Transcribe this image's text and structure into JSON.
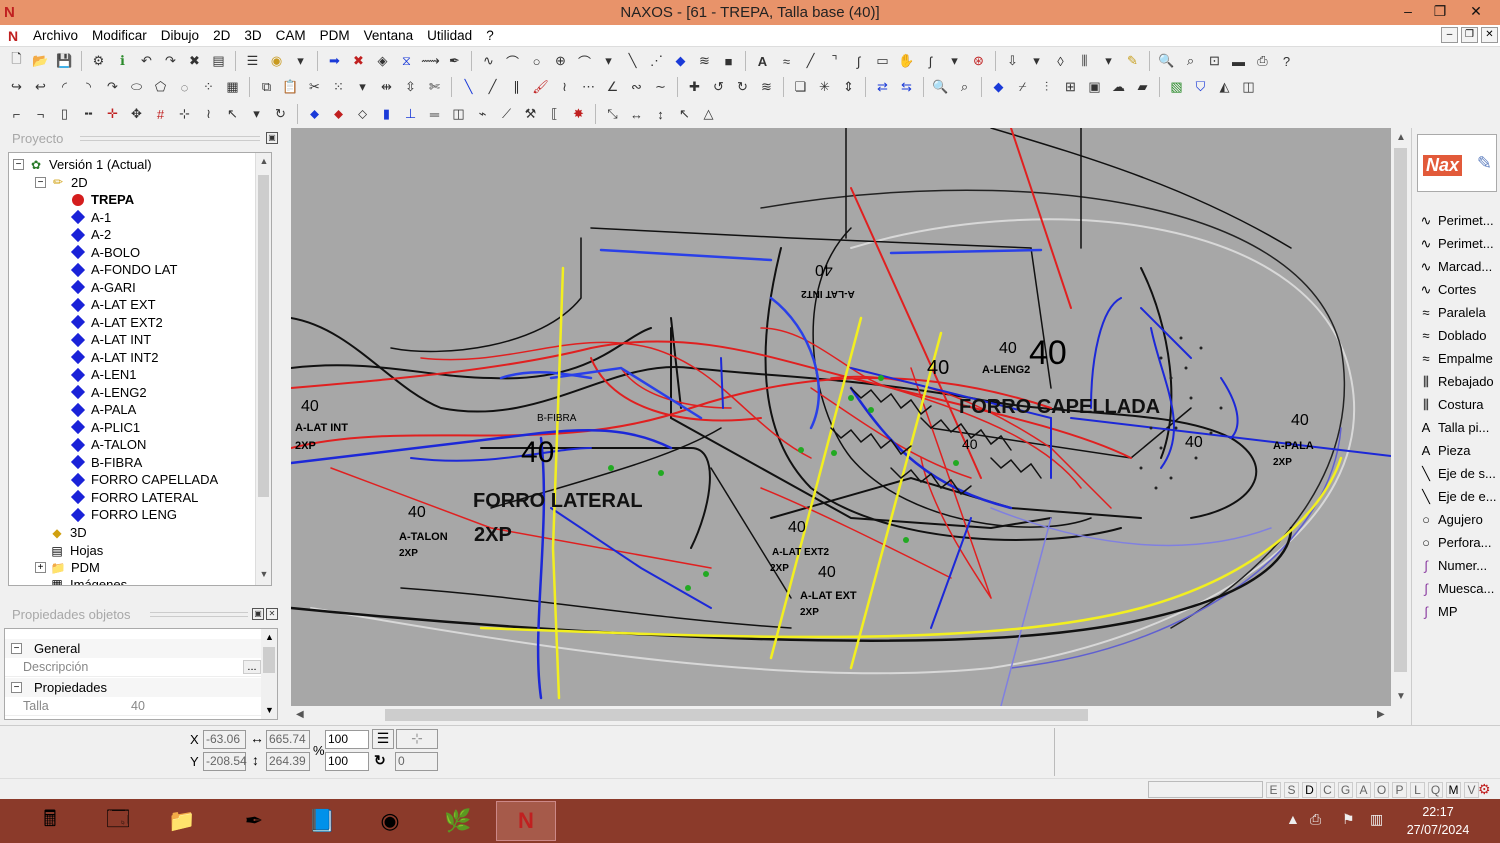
{
  "window": {
    "title": "NAXOS - [61 - TREPA, Talla base (40)]",
    "minimize": "–",
    "maximize": "❐",
    "close": "✕"
  },
  "menu": [
    "Archivo",
    "Modificar",
    "Dibujo",
    "2D",
    "3D",
    "CAM",
    "PDM",
    "Ventana",
    "Utilidad",
    "?"
  ],
  "project_panel": {
    "title": "Proyecto",
    "version": "Versión 1 (Actual)",
    "group_2d": "2D",
    "items": [
      "TREPA",
      "A-1",
      "A-2",
      "A-BOLO",
      "A-FONDO LAT",
      "A-GARI",
      "A-LAT EXT",
      "A-LAT EXT2",
      "A-LAT INT",
      "A-LAT INT2",
      "A-LEN1",
      "A-LENG2",
      "A-PALA",
      "A-PLIC1",
      "A-TALON",
      "B-FIBRA",
      "FORRO CAPELLADA",
      "FORRO LATERAL",
      "FORRO LENG"
    ],
    "group_3d": "3D",
    "hojas": "Hojas",
    "pdm": "PDM",
    "imagenes": "Imágenes"
  },
  "properties_panel": {
    "title": "Propiedades objetos",
    "cat_general": "General",
    "descripcion_label": "Descripción",
    "descripcion_value": "",
    "ellipsis": "...",
    "cat_propiedades": "Propiedades",
    "talla_label": "Talla",
    "talla_value": "40"
  },
  "canvas_labels": {
    "forro_lateral": "FORRO LATERAL",
    "forro_lateral_2xp": "2XP",
    "forro_capellada": "FORRO CAPELLADA",
    "a_lat_int": "A-LAT INT",
    "a_talon": "A-TALON",
    "a_lat_ext": "A-LAT EXT",
    "a_lat_ext2": "A-LAT EXT2",
    "a_leng2": "A-LENG2",
    "a_pala": "A-PALA",
    "a_lat_int2": "A-LAT INT2",
    "b_fibra": "B-FIBRA",
    "xp": "2XP",
    "size": "40"
  },
  "palette": [
    "Perimet...",
    "Perimet...",
    "Marcad...",
    "Cortes",
    "Paralela",
    "Doblado",
    "Empalme",
    "Rebajado",
    "Costura",
    "Talla pi...",
    "Pieza",
    "Eje de s...",
    "Eje de e...",
    "Agujero",
    "Perfora...",
    "Numer...",
    "Muesca...",
    "MP"
  ],
  "logo": "Nax",
  "coords": {
    "x_label": "X",
    "y_label": "Y",
    "x": "-63.06",
    "y": "-208.54",
    "width": "665.74",
    "height": "264.39",
    "percent_label": "%",
    "scale_x": "100",
    "scale_y": "100",
    "rotation": "0"
  },
  "status_letters": [
    "E",
    "S",
    "D",
    "C",
    "G",
    "A",
    "O",
    "P",
    "L",
    "Q",
    "M",
    "V"
  ],
  "taskbar": {
    "time": "22:17",
    "date": "27/07/2024"
  }
}
